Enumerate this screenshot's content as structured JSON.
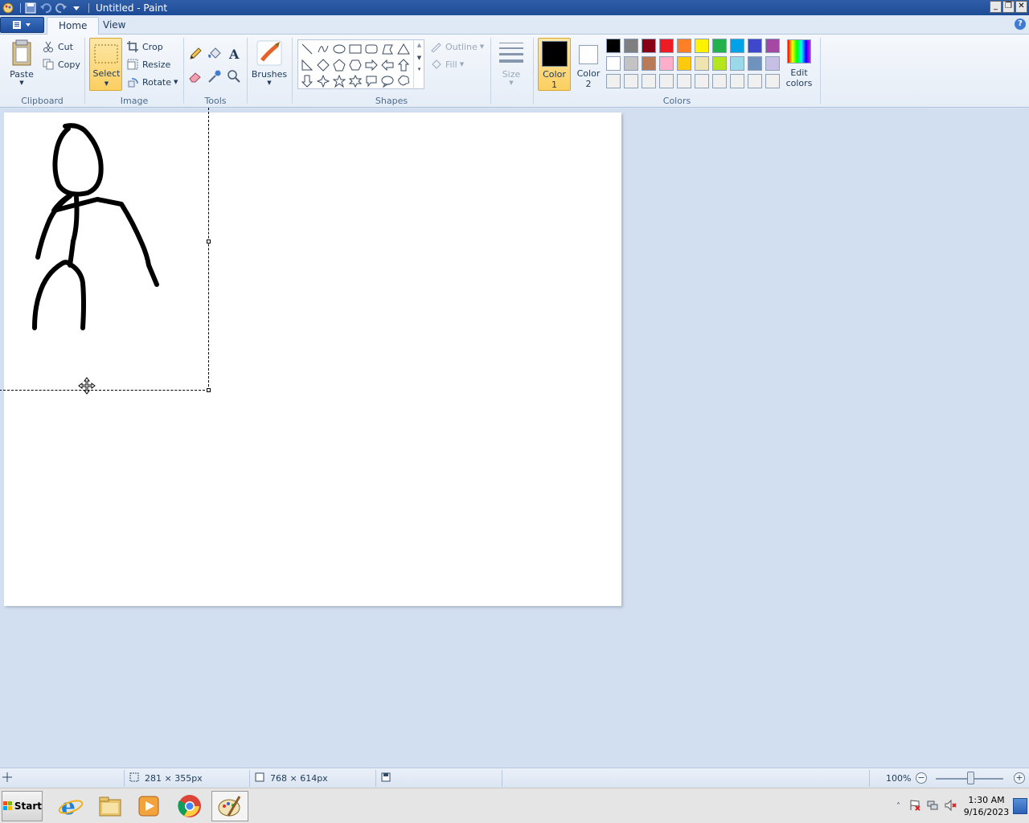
{
  "window": {
    "title": "Untitled - Paint",
    "controls": [
      "minimize",
      "restore",
      "close"
    ]
  },
  "tabs": [
    {
      "label": "Home",
      "active": true
    },
    {
      "label": "View",
      "active": false
    }
  ],
  "help_label": "?",
  "ribbon": {
    "clipboard": {
      "group_label": "Clipboard",
      "paste": "Paste",
      "cut": "Cut",
      "copy": "Copy"
    },
    "image": {
      "group_label": "Image",
      "select": "Select",
      "crop": "Crop",
      "resize": "Resize",
      "rotate": "Rotate"
    },
    "tools": {
      "group_label": "Tools",
      "items": [
        "pencil-icon",
        "fill-bucket-icon",
        "text-icon",
        "eraser-icon",
        "color-picker-icon",
        "magnifier-icon"
      ]
    },
    "brushes": {
      "label": "Brushes"
    },
    "shapes": {
      "group_label": "Shapes",
      "outline": "Outline",
      "fill": "Fill"
    },
    "size": {
      "label": "Size"
    },
    "colors": {
      "group_label": "Colors",
      "color1": "Color",
      "color1_num": "1",
      "color2": "Color",
      "color2_num": "2",
      "edit_line1": "Edit",
      "edit_line2": "colors",
      "color1_value": "#000000",
      "color2_value": "#ffffff",
      "palette_row1": [
        "#000000",
        "#7f7f7f",
        "#880015",
        "#ed1c24",
        "#ff7f27",
        "#fff200",
        "#22b14c",
        "#00a2e8",
        "#3f48cc",
        "#a349a4"
      ],
      "palette_row2": [
        "#ffffff",
        "#c3c3c3",
        "#b97a57",
        "#ffaec9",
        "#ffc90e",
        "#efe4b0",
        "#b5e61d",
        "#99d9ea",
        "#7092be",
        "#c8bfe7"
      ],
      "palette_row3": [
        "#f0f0f0",
        "#f0f0f0",
        "#f0f0f0",
        "#f0f0f0",
        "#f0f0f0",
        "#f0f0f0",
        "#f0f0f0",
        "#f0f0f0",
        "#f0f0f0",
        "#f0f0f0"
      ]
    }
  },
  "canvas": {
    "drawing": "stick-figure",
    "selection_active": true
  },
  "statusbar": {
    "selection_size": "281 × 355px",
    "canvas_size": "768 × 614px",
    "zoom": "100%"
  },
  "taskbar": {
    "start": "Start",
    "apps": [
      "internet-explorer-icon",
      "file-explorer-icon",
      "media-player-icon",
      "chrome-icon",
      "paint-icon"
    ],
    "clock_time": "1:30 AM",
    "clock_date": "9/16/2023"
  }
}
